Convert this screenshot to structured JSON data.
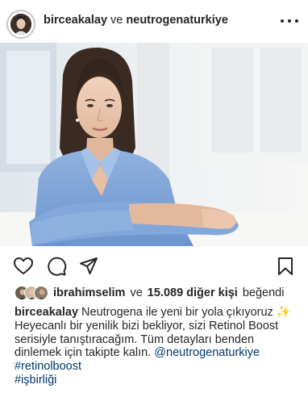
{
  "post": {
    "author": "bircea kalay",
    "author_handle": "bircеakalay",
    "connector": "ve",
    "collaborator": "neutrogenaturkiye"
  },
  "likes": {
    "first_user": "ibrahimselim",
    "connector": "ve",
    "count_text": "15.089 diğer kişi",
    "suffix": "beğendi"
  },
  "caption": {
    "username": "bircеakalay",
    "line1": "Neutrogena ile yeni bir yola çıkıyoruz ✨",
    "line2": "Heyecanlı bir yenilik bizi bekliyor, sizi Retinol Boost",
    "line3": "serisiyle tanıştıracağım. Tüm detayları benden",
    "line4": "dinlemek için takipte kalın.",
    "mention": "@neutrogenaturkiye",
    "hashtag1": "#retinolboost",
    "hashtag2": "#işbirliği"
  },
  "icons": {
    "more": "more-icon",
    "like": "heart-icon",
    "comment": "comment-icon",
    "share": "share-icon",
    "save": "bookmark-icon"
  },
  "colors": {
    "text": "#262626",
    "link": "#00376b",
    "shirt": "#7ea3d6"
  }
}
